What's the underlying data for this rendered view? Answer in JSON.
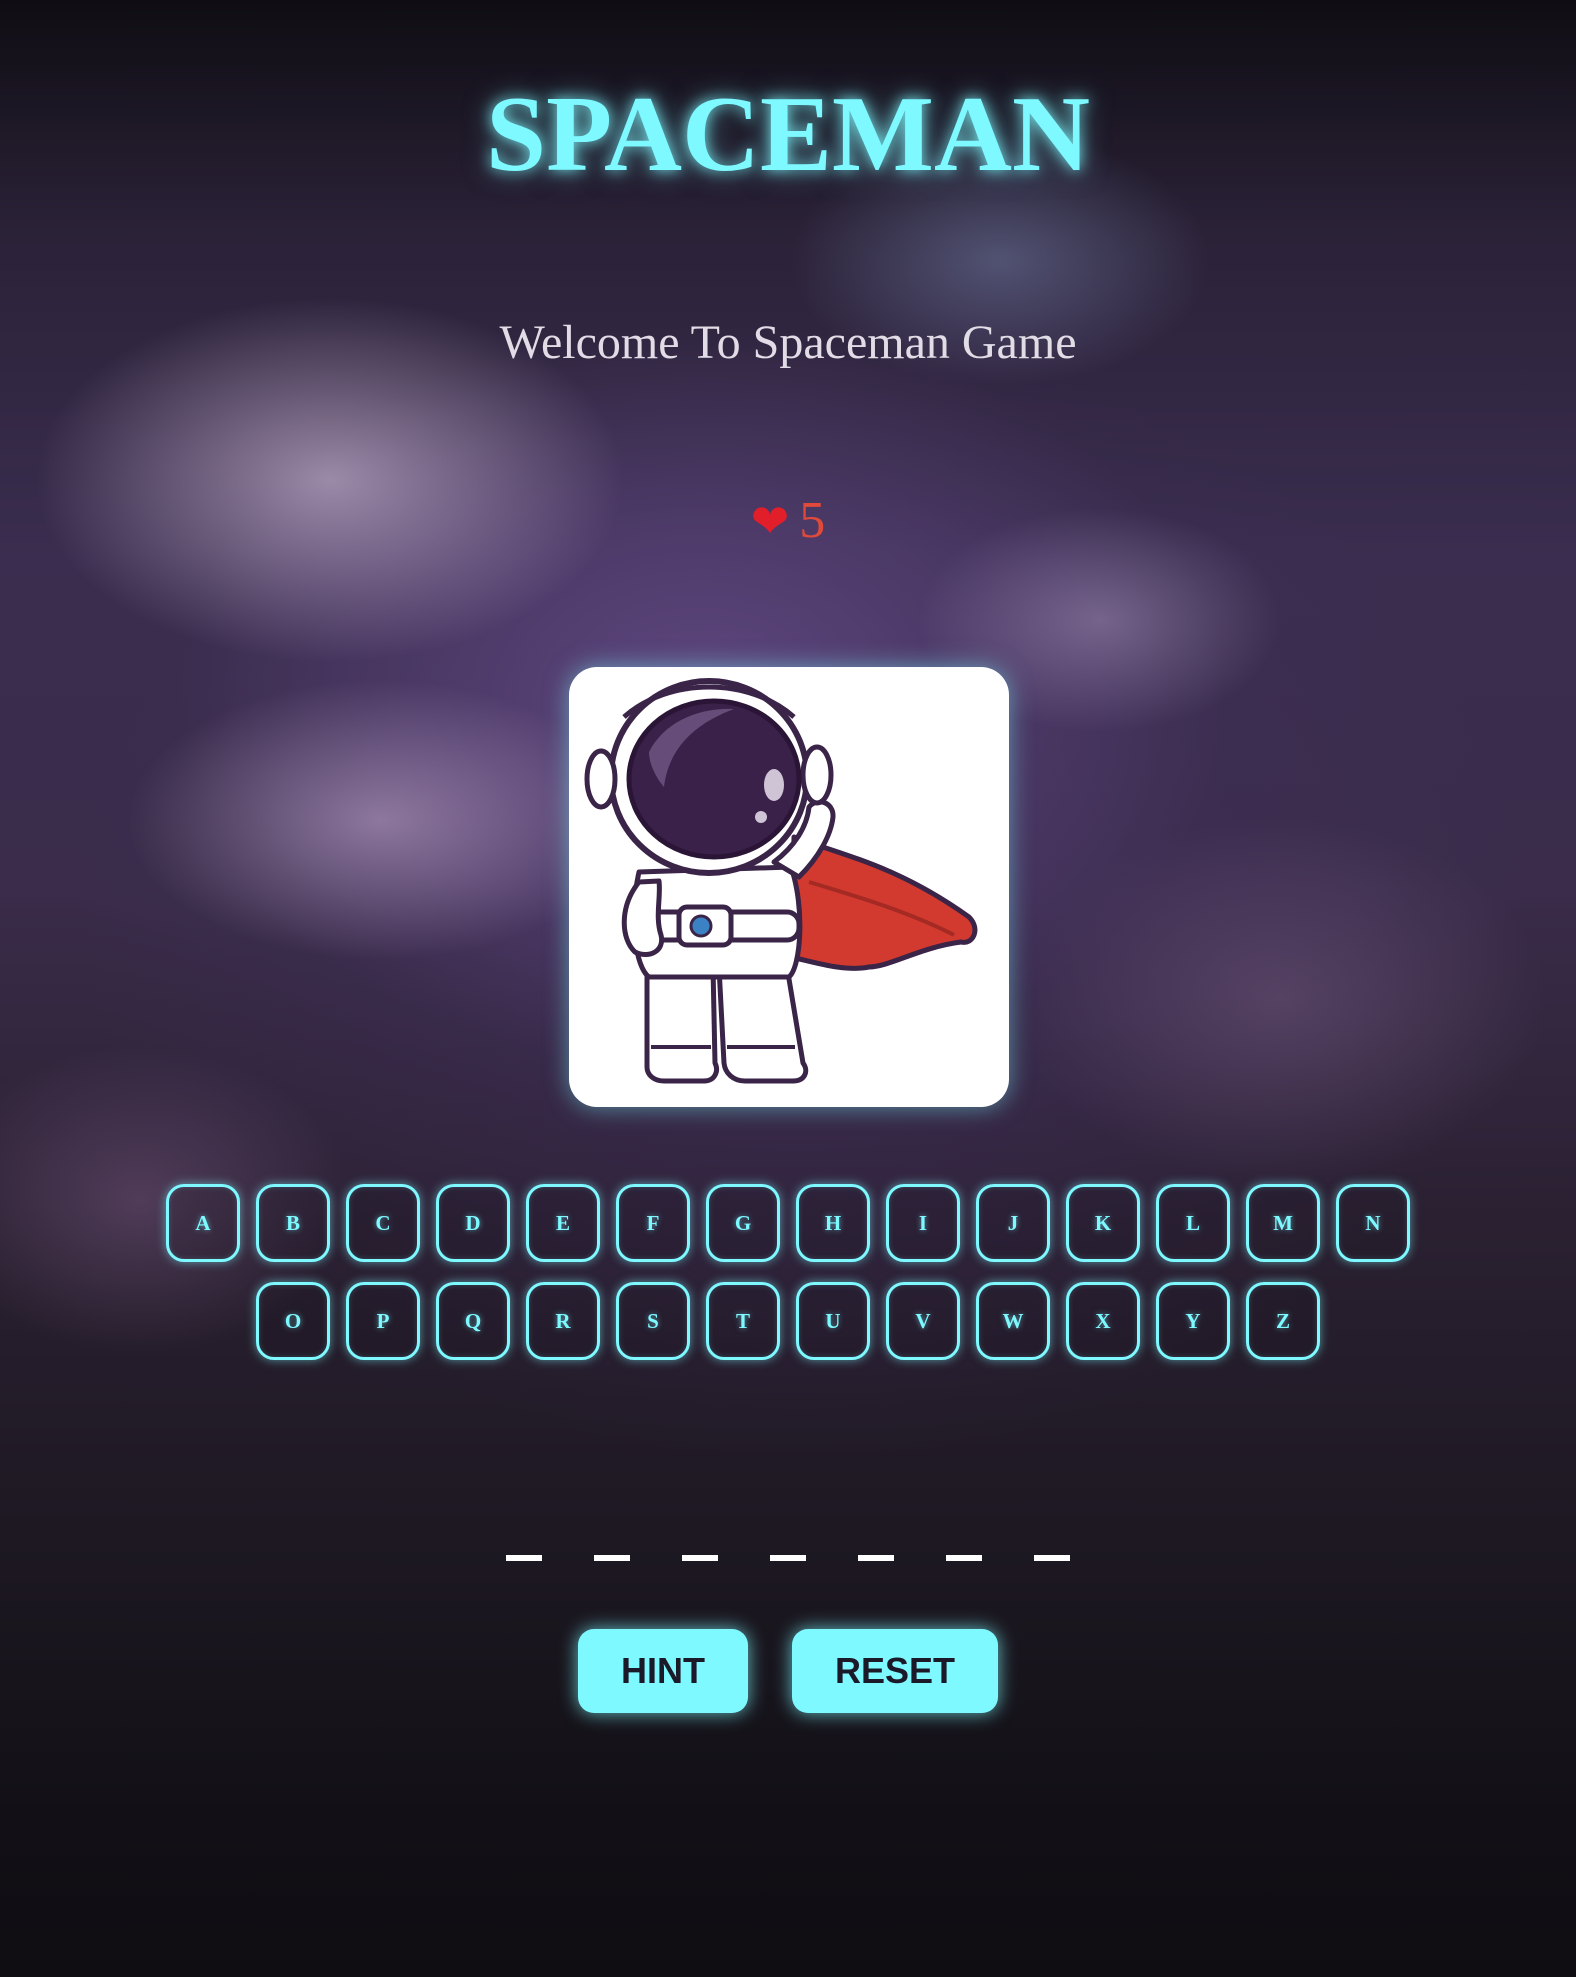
{
  "game": {
    "title": "SPACEMAN",
    "welcome": "Welcome To Spaceman Game",
    "lives": "5",
    "heart_icon": "heart-icon",
    "image": "astronaut-with-red-cape",
    "accent_color": "#7df9ff",
    "lives_color": "#e14a3a"
  },
  "keyboard": {
    "row1": [
      "A",
      "B",
      "C",
      "D",
      "E",
      "F",
      "G",
      "H",
      "I",
      "J",
      "K",
      "L",
      "M",
      "N"
    ],
    "row2": [
      "O",
      "P",
      "Q",
      "R",
      "S",
      "T",
      "U",
      "V",
      "W",
      "X",
      "Y",
      "Z"
    ]
  },
  "word": {
    "blanks": [
      "_",
      "_",
      "_",
      "_",
      "_",
      "_",
      "_"
    ]
  },
  "actions": {
    "hint_label": "HINT",
    "reset_label": "RESET"
  }
}
